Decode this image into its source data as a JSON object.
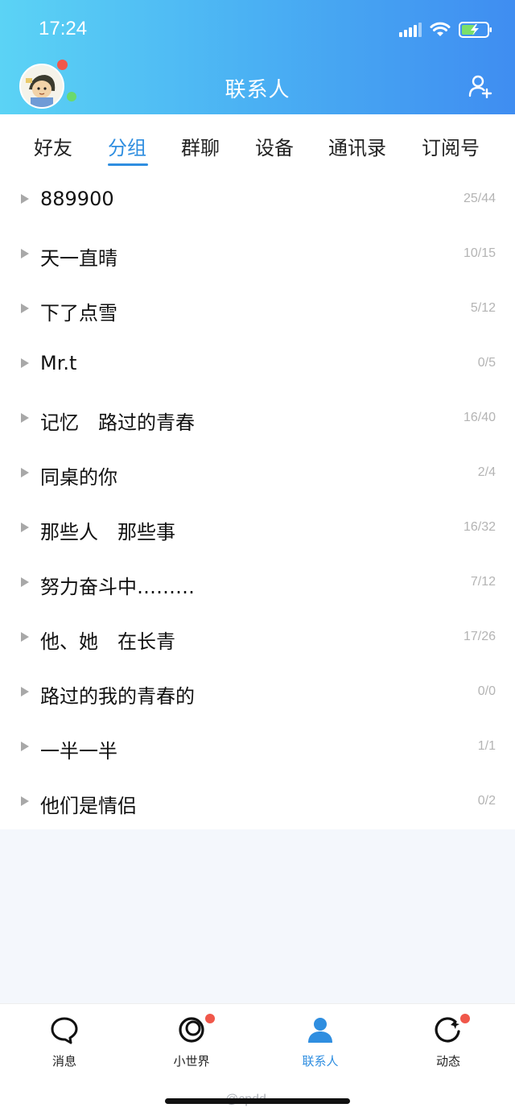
{
  "status_bar": {
    "time": "17:24"
  },
  "header": {
    "title": "联系人",
    "avatar_icon": "avatar-cartoon",
    "add_icon": "add-contact-icon"
  },
  "tabs": [
    {
      "label": "好友",
      "active": false
    },
    {
      "label": "分组",
      "active": true
    },
    {
      "label": "群聊",
      "active": false
    },
    {
      "label": "设备",
      "active": false
    },
    {
      "label": "通讯录",
      "active": false
    },
    {
      "label": "订阅号",
      "active": false
    }
  ],
  "groups": [
    {
      "name": "889900",
      "count": "25/44"
    },
    {
      "name": "天一直晴",
      "count": "10/15"
    },
    {
      "name": "下了点雪",
      "count": "5/12"
    },
    {
      "name": "Mr.t",
      "count": "0/5"
    },
    {
      "name": "记忆　路过的青春",
      "count": "16/40"
    },
    {
      "name": "同桌的你",
      "count": "2/4"
    },
    {
      "name": "那些人　那些事",
      "count": "16/32"
    },
    {
      "name": "努力奋斗中………",
      "count": "7/12"
    },
    {
      "name": "他、她　在长青",
      "count": "17/26"
    },
    {
      "name": "路过的我的青春的",
      "count": "0/0"
    },
    {
      "name": "一半一半",
      "count": "1/1"
    },
    {
      "name": "他们是情侣",
      "count": "0/2"
    }
  ],
  "bottom_nav": [
    {
      "label": "消息",
      "icon": "chat-bubble-icon",
      "active": false,
      "badge": false
    },
    {
      "label": "小世界",
      "icon": "world-ring-icon",
      "active": false,
      "badge": true
    },
    {
      "label": "联系人",
      "icon": "person-icon",
      "active": true,
      "badge": false
    },
    {
      "label": "动态",
      "icon": "star-circle-icon",
      "active": false,
      "badge": true
    }
  ],
  "watermark": "@cpdd",
  "colors": {
    "accent": "#2f8ee0",
    "header_start": "#5bd3f5",
    "header_end": "#3f8df1",
    "badge": "#f0574a"
  }
}
